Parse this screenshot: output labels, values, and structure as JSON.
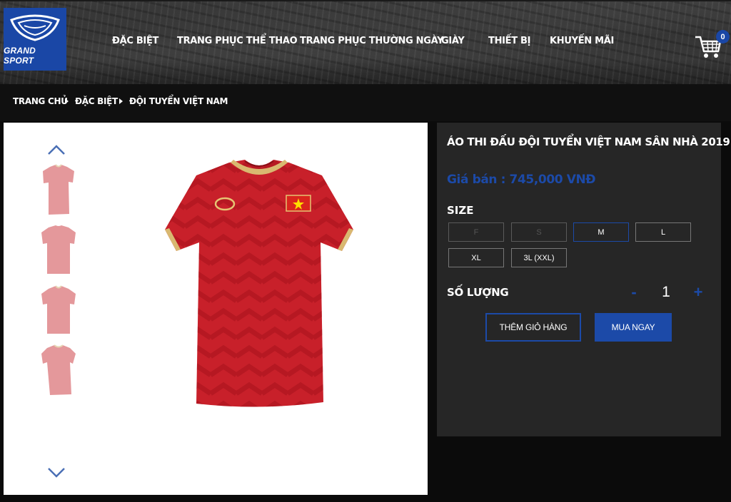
{
  "brand": {
    "logo_text": "GRAND SPORT",
    "color": "#1a47a6"
  },
  "nav": {
    "items": [
      {
        "label": "ĐẶC BIỆT"
      },
      {
        "label": "TRANG PHỤC THỂ THAO"
      },
      {
        "label": "TRANG PHỤC THƯỜNG NGÀY"
      },
      {
        "label": "GIÀY"
      },
      {
        "label": "THIẾT BỊ"
      },
      {
        "label": "KHUYẾN MÃI"
      }
    ]
  },
  "cart": {
    "icon": "shopping-cart-icon",
    "count": "0"
  },
  "breadcrumb": [
    {
      "label": "TRANG CHỦ"
    },
    {
      "label": "ĐẶC BIỆT"
    },
    {
      "label": "ĐỘI TUYỂN VIỆT NAM"
    }
  ],
  "gallery": {
    "up_icon": "chevron-up-icon",
    "down_icon": "chevron-down-icon",
    "thumbnails": 4
  },
  "product": {
    "title": "ÁO THI ĐẤU ĐỘI TUYỂN VIỆT NAM SÂN NHÀ 2019",
    "price": "Giá bán : 745,000 VNĐ",
    "size_label": "SIZE",
    "sizes": [
      {
        "label": "F",
        "state": "disabled"
      },
      {
        "label": "S",
        "state": "disabled"
      },
      {
        "label": "M",
        "state": "selected"
      },
      {
        "label": "L",
        "state": "available"
      },
      {
        "label": "XL",
        "state": "available"
      },
      {
        "label": "3L (XXL)",
        "state": "available"
      }
    ],
    "quantity_label": "SỐ LƯỢNG",
    "minus": "-",
    "quantity": "1",
    "plus": "+",
    "add_to_cart": "THÊM GIỎ HÀNG",
    "buy_now": "MUA NGAY",
    "accent": "#1c4aa8"
  }
}
